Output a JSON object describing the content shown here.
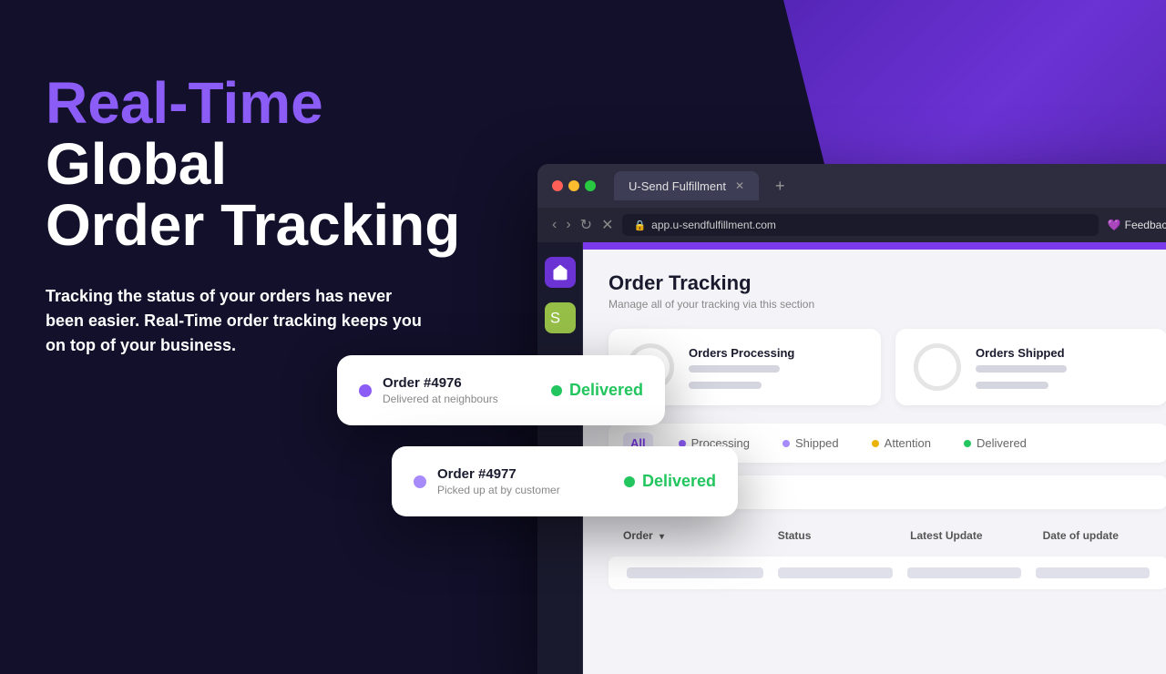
{
  "page": {
    "background_color": "#12102a"
  },
  "hero": {
    "title_highlight": "Real-Time",
    "title_rest": " Global\nOrder Tracking",
    "description": "Tracking the status of your orders has never been easier. Real-Time order tracking keeps you on top of your business."
  },
  "order_cards": [
    {
      "id": "card-1",
      "order_number": "Order #4976",
      "subtitle": "Delivered at neighbours",
      "status": "Delivered"
    },
    {
      "id": "card-2",
      "order_number": "Order #4977",
      "subtitle": "Picked up at by customer",
      "status": "Delivered"
    }
  ],
  "browser": {
    "tab_title": "U-Send Fulfillment",
    "url": "app.u-sendfulfillment.com",
    "feedback_label": "Feedback?"
  },
  "app": {
    "page_title": "Order Tracking",
    "page_subtitle": "Manage all of your tracking via this section",
    "stats": [
      {
        "label": "Orders Processing",
        "id": "processing"
      },
      {
        "label": "Orders Shipped",
        "id": "shipped"
      }
    ],
    "filters": [
      {
        "label": "All",
        "active": true,
        "color": "#7c3aed"
      },
      {
        "label": "Processing",
        "active": false,
        "color": "#8b5cf6"
      },
      {
        "label": "Shipped",
        "active": false,
        "color": "#a78bfa"
      },
      {
        "label": "Attention",
        "active": false,
        "color": "#eab308"
      },
      {
        "label": "Delivered",
        "active": false,
        "color": "#22c55e"
      }
    ],
    "table_headers": [
      "Order",
      "Status",
      "Latest Update",
      "Date of update"
    ],
    "search_placeholder": ""
  }
}
